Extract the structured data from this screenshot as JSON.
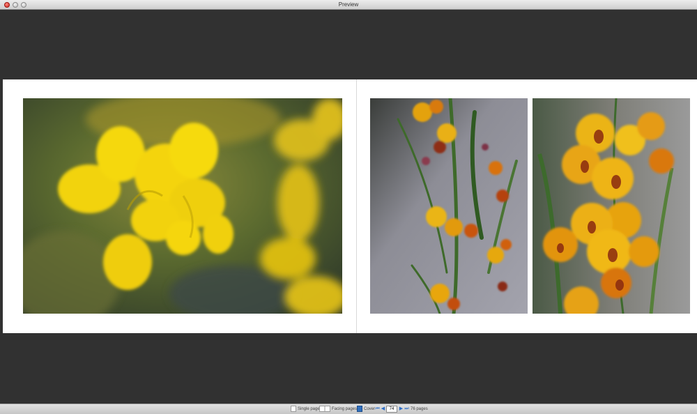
{
  "window": {
    "title": "Preview"
  },
  "spread": {
    "left_page": {
      "photos": [
        {
          "subject": "yellow-broom-flowers"
        }
      ]
    },
    "right_page": {
      "photos": [
        {
          "subject": "orange-pea-flowers-stem"
        },
        {
          "subject": "orange-pea-flowers-closeup"
        }
      ]
    }
  },
  "statusbar": {
    "single_page_label": "Single page",
    "facing_pages_label": "Facing pages",
    "cover_label": "Cover",
    "current_page": "74",
    "total_pages_label": "76 pages",
    "icons": [
      "single-page-icon",
      "facing-pages-icon",
      "cover-icon",
      "first-page-icon",
      "prev-page-icon",
      "next-page-icon",
      "last-page-icon"
    ]
  },
  "colors": {
    "background": "#313131",
    "page": "#ffffff",
    "accent": "#2e6fc8"
  }
}
